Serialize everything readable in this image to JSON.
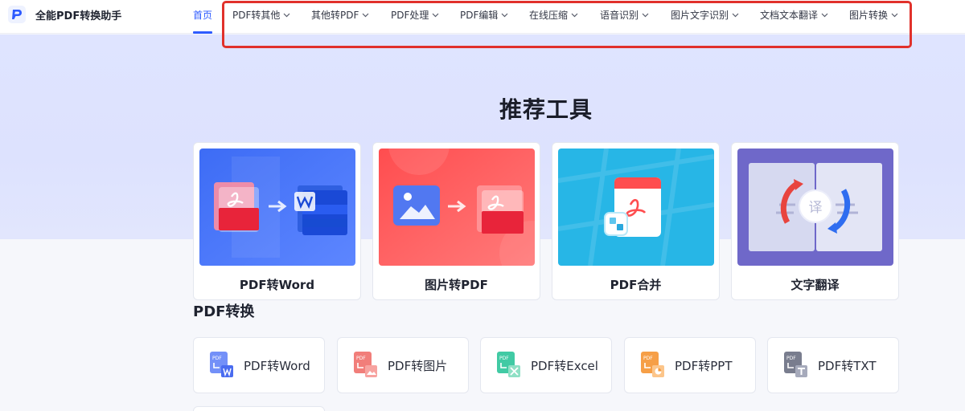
{
  "app": {
    "name": "全能PDF转换助手"
  },
  "nav": {
    "home": "首页",
    "items": [
      "PDF转其他",
      "其他转PDF",
      "PDF处理",
      "PDF编辑",
      "在线压缩",
      "语音识别",
      "图片文字识别",
      "文档文本翻译",
      "图片转换"
    ]
  },
  "hero": {
    "title": "推荐工具"
  },
  "recommended": [
    {
      "label": "PDF转Word"
    },
    {
      "label": "图片转PDF"
    },
    {
      "label": "PDF合并"
    },
    {
      "label": "文字翻译"
    }
  ],
  "recommended_art": {
    "translate_glyph": "译",
    "pdf_tag": "PDF"
  },
  "section": {
    "title": "PDF转换"
  },
  "tools": [
    {
      "label": "PDF转Word",
      "icon": "pdf-to-word-icon",
      "color": "#5b7cf7"
    },
    {
      "label": "PDF转图片",
      "icon": "pdf-to-image-icon",
      "color": "#f0706c"
    },
    {
      "label": "PDF转Excel",
      "icon": "pdf-to-excel-icon",
      "color": "#2cc49a"
    },
    {
      "label": "PDF转PPT",
      "icon": "pdf-to-ppt-icon",
      "color": "#f59a3d"
    },
    {
      "label": "PDF转TXT",
      "icon": "pdf-to-txt-icon",
      "color": "#6a6f82"
    }
  ],
  "colors": {
    "accent": "#2e5bff",
    "highlight": "#e1312b"
  }
}
